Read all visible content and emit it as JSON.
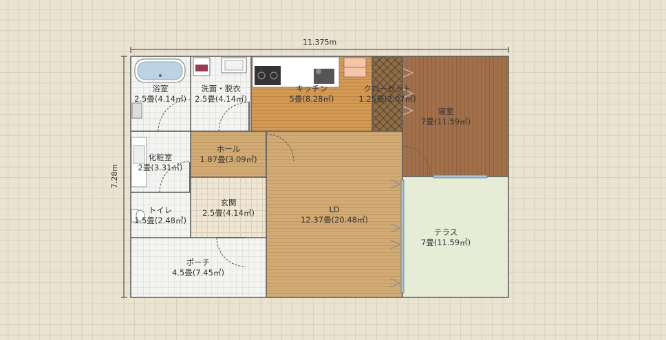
{
  "dimensions": {
    "width": "11.375m",
    "height": "7.28m"
  },
  "rooms": {
    "bath": {
      "name": "浴室",
      "area": "2.5畳(4.14㎡)"
    },
    "wash": {
      "name": "洗面・脱衣",
      "area": "2.5畳(4.14㎡)"
    },
    "kitchen": {
      "name": "キッチン",
      "area": "5畳(8.28㎡)"
    },
    "closet": {
      "name": "クローゼット",
      "area": "1.25畳(2.07㎡)"
    },
    "bedroom": {
      "name": "寝室",
      "area": "7畳(11.59㎡)"
    },
    "hall": {
      "name": "ホール",
      "area": "1.87畳(3.09㎡)"
    },
    "powder": {
      "name": "化粧室",
      "area": "2畳(3.31㎡)"
    },
    "toilet": {
      "name": "トイレ",
      "area": "1.5畳(2.48㎡)"
    },
    "entrance": {
      "name": "玄関",
      "area": "2.5畳(4.14㎡)"
    },
    "ld": {
      "name": "LD",
      "area": "12.37畳(20.48㎡)"
    },
    "terrace": {
      "name": "テラス",
      "area": "7畳(11.59㎡)"
    },
    "porch": {
      "name": "ポーチ",
      "area": "4.5畳(7.45㎡)"
    }
  },
  "icons": [
    "bathtub-icon",
    "washing-machine-icon",
    "sink-icon",
    "stove-icon",
    "kitchen-sink-icon",
    "refrigerator-icon",
    "toilet-icon",
    "door-swing-icon",
    "sliding-door-icon"
  ]
}
